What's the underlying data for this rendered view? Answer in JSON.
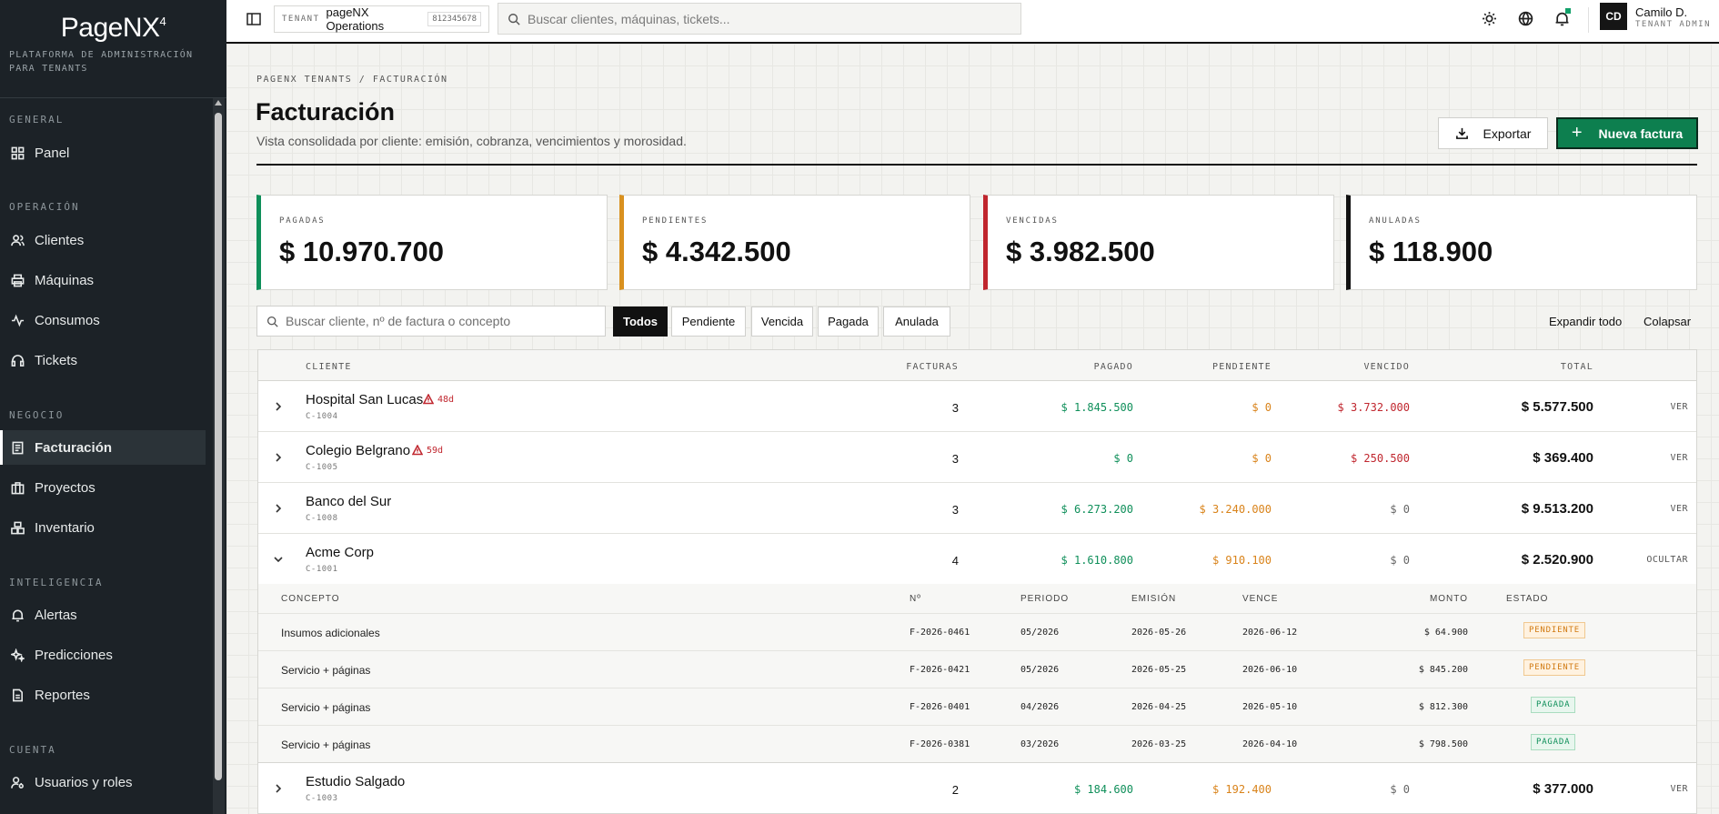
{
  "brand": {
    "name": "PageNX",
    "mark": "4",
    "tagline": "PLATAFORMA DE ADMINISTRACIÓN PARA TENANTS"
  },
  "sidebar": {
    "sections": [
      {
        "title": "GENERAL",
        "items": [
          {
            "label": "Panel",
            "icon": "grid-icon"
          }
        ]
      },
      {
        "title": "OPERACIÓN",
        "items": [
          {
            "label": "Clientes",
            "icon": "users-icon"
          },
          {
            "label": "Máquinas",
            "icon": "printer-icon"
          },
          {
            "label": "Consumos",
            "icon": "activity-icon"
          },
          {
            "label": "Tickets",
            "icon": "headset-icon"
          }
        ]
      },
      {
        "title": "NEGOCIO",
        "items": [
          {
            "label": "Facturación",
            "icon": "invoice-icon",
            "active": true
          },
          {
            "label": "Proyectos",
            "icon": "briefcase-icon"
          },
          {
            "label": "Inventario",
            "icon": "boxes-icon"
          }
        ]
      },
      {
        "title": "INTELIGENCIA",
        "items": [
          {
            "label": "Alertas",
            "icon": "bell-icon"
          },
          {
            "label": "Predicciones",
            "icon": "sparkle-icon"
          },
          {
            "label": "Reportes",
            "icon": "report-icon"
          }
        ]
      },
      {
        "title": "CUENTA",
        "items": [
          {
            "label": "Usuarios y roles",
            "icon": "user-key-icon"
          }
        ]
      }
    ]
  },
  "topbar": {
    "tenant_label": "TENANT",
    "tenant_name": "pageNX Operations",
    "tenant_id": "812345678",
    "search_placeholder": "Buscar clientes, máquinas, tickets...",
    "user_initials": "CD",
    "user_name": "Camilo D.",
    "user_role": "TENANT ADMIN"
  },
  "page": {
    "breadcrumb": "PAGENX TENANTS / FACTURACIÓN",
    "title": "Facturación",
    "subtitle": "Vista consolidada por cliente: emisión, cobranza, vencimientos y morosidad.",
    "export_label": "Exportar",
    "new_label": "Nueva factura"
  },
  "summary": [
    {
      "label": "PAGADAS",
      "value": "$ 10.970.700",
      "color": "#0f8f5a"
    },
    {
      "label": "PENDIENTES",
      "value": "$ 4.342.500",
      "color": "#d9911f"
    },
    {
      "label": "VENCIDAS",
      "value": "$ 3.982.500",
      "color": "#c0262e"
    },
    {
      "label": "ANULADAS",
      "value": "$ 118.900",
      "color": "#111111"
    }
  ],
  "filters": {
    "search_placeholder": "Buscar cliente, nº de factura o concepto",
    "chips": [
      "Todos",
      "Pendiente",
      "Vencida",
      "Pagada",
      "Anulada"
    ],
    "active_chip": "Todos",
    "expand_all": "Expandir todo",
    "collapse": "Colapsar"
  },
  "table": {
    "headers": [
      "CLIENTE",
      "FACTURAS",
      "PAGADO",
      "PENDIENTE",
      "VENCIDO",
      "TOTAL"
    ],
    "rows": [
      {
        "name": "Hospital San Lucas",
        "id": "C-1004",
        "badge": "48d",
        "facturas": "3",
        "pagado": "$ 1.845.500",
        "pendiente": "$ 0",
        "vencido": "$ 3.732.000",
        "total": "$ 5.577.500",
        "action": "VER"
      },
      {
        "name": "Colegio Belgrano",
        "id": "C-1005",
        "badge": "59d",
        "facturas": "3",
        "pagado": "$ 0",
        "pendiente": "$ 0",
        "vencido": "$ 250.500",
        "total": "$ 369.400",
        "action": "VER"
      },
      {
        "name": "Banco del Sur",
        "id": "C-1008",
        "badge": "",
        "facturas": "3",
        "pagado": "$ 6.273.200",
        "pendiente": "$ 3.240.000",
        "vencido": "$ 0",
        "total": "$ 9.513.200",
        "action": "VER"
      },
      {
        "name": "Acme Corp",
        "id": "C-1001",
        "badge": "",
        "facturas": "4",
        "pagado": "$ 1.610.800",
        "pendiente": "$ 910.100",
        "vencido": "$ 0",
        "total": "$ 2.520.900",
        "action": "OCULTAR"
      },
      {
        "name": "Estudio Salgado",
        "id": "C-1003",
        "badge": "",
        "facturas": "2",
        "pagado": "$ 184.600",
        "pendiente": "$ 192.400",
        "vencido": "$ 0",
        "total": "$ 377.000",
        "action": "VER"
      }
    ],
    "detail": {
      "headers": [
        "CONCEPTO",
        "Nº",
        "PERIODO",
        "EMISIÓN",
        "VENCE",
        "MONTO",
        "ESTADO"
      ],
      "rows": [
        {
          "concepto": "Insumos adicionales",
          "numero": "F-2026-0461",
          "periodo": "05/2026",
          "emision": "2026-05-26",
          "vence": "2026-06-12",
          "monto": "$ 64.900",
          "estado": "PENDIENTE"
        },
        {
          "concepto": "Servicio + páginas",
          "numero": "F-2026-0421",
          "periodo": "05/2026",
          "emision": "2026-05-25",
          "vence": "2026-06-10",
          "monto": "$ 845.200",
          "estado": "PENDIENTE"
        },
        {
          "concepto": "Servicio + páginas",
          "numero": "F-2026-0401",
          "periodo": "04/2026",
          "emision": "2026-04-25",
          "vence": "2026-05-10",
          "monto": "$ 812.300",
          "estado": "PAGADA"
        },
        {
          "concepto": "Servicio + páginas",
          "numero": "F-2026-0381",
          "periodo": "03/2026",
          "emision": "2026-03-25",
          "vence": "2026-04-10",
          "monto": "$ 798.500",
          "estado": "PAGADA"
        }
      ]
    }
  }
}
